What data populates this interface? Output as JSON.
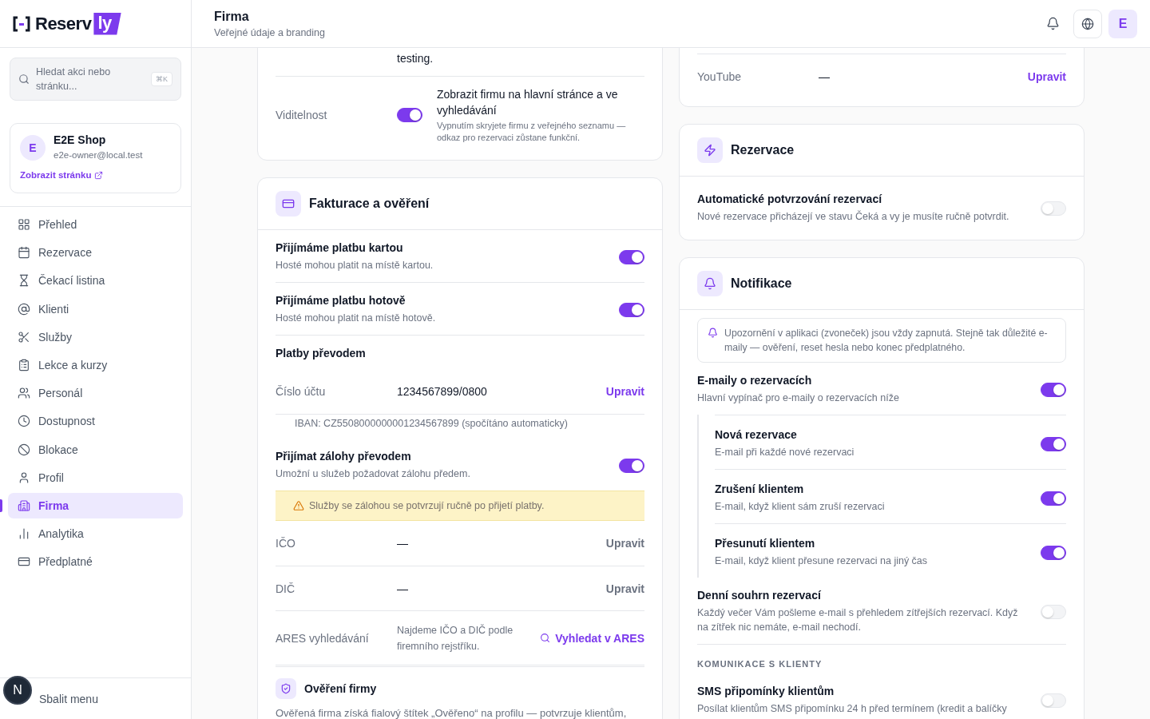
{
  "brand": {
    "name": "Reserv",
    "badge": "ly"
  },
  "search": {
    "placeholder": "Hledat akci nebo stránku...",
    "shortcut": "⌘K"
  },
  "shop": {
    "avatar": "E",
    "name": "E2E Shop",
    "email": "e2e-owner@local.test",
    "link": "Zobrazit stránku"
  },
  "nav": [
    {
      "label": "Přehled",
      "selected": false
    },
    {
      "label": "Rezervace",
      "selected": false
    },
    {
      "label": "Čekací listina",
      "selected": false
    },
    {
      "label": "Klienti",
      "selected": false
    },
    {
      "label": "Služby",
      "selected": false
    },
    {
      "label": "Lekce a kurzy",
      "selected": false
    },
    {
      "label": "Personál",
      "selected": false
    },
    {
      "label": "Dostupnost",
      "selected": false
    },
    {
      "label": "Blokace",
      "selected": false
    },
    {
      "label": "Profil",
      "selected": false
    },
    {
      "label": "Firma",
      "selected": true
    },
    {
      "label": "Analytika",
      "selected": false
    },
    {
      "label": "Předplatné",
      "selected": false
    }
  ],
  "collapse": "Sbalit menu",
  "dev_badge": "N",
  "header": {
    "title": "Firma",
    "subtitle": "Veřejné údaje a branding",
    "avatar": "E"
  },
  "profile_card": {
    "rows": [
      {
        "kind": "text",
        "value": "testing."
      },
      {
        "kind": "toggle",
        "label": "Viditelnost",
        "on": true,
        "title": "Zobrazit firmu na hlavní stránce a ve vyhledávání",
        "description": "Vypnutím skryjete firmu z veřejného seznamu — odkaz pro rezervaci zůstane funkční."
      }
    ]
  },
  "billing": {
    "title": "Fakturace a ověření",
    "items": [
      {
        "kind": "toggle",
        "title": "Přijímáme platbu kartou",
        "description": "Hosté mohou platit na místě kartou.",
        "on": true
      },
      {
        "kind": "toggle",
        "title": "Přijímáme platbu hotově",
        "description": "Hosté mohou platit na místě hotově.",
        "on": true
      },
      {
        "kind": "subheading",
        "title": "Platby převodem"
      },
      {
        "kind": "field",
        "label": "Číslo účtu",
        "value": "1234567899/0800",
        "action": "Upravit",
        "disabled": false
      },
      {
        "kind": "note",
        "text": "IBAN: CZ5508000000001234567899 (spočítáno automaticky)"
      },
      {
        "kind": "toggle",
        "title": "Přijímat zálohy převodem",
        "description": "Umožní u služeb požadovat zálohu předem.",
        "on": true
      },
      {
        "kind": "alert",
        "text": "Služby se zálohou se potvrzují ručně po přijetí platby."
      },
      {
        "kind": "field",
        "label": "IČO",
        "value": "—",
        "action": "Upravit",
        "disabled": true
      },
      {
        "kind": "field",
        "label": "DIČ",
        "value": "—",
        "action": "Upravit",
        "disabled": true
      },
      {
        "kind": "ares",
        "label": "ARES vyhledávání",
        "value": "Najdeme IČO a DIČ podle firemního rejstříku.",
        "action": "Vyhledat v ARES"
      },
      {
        "kind": "section",
        "title": "Ověření firmy",
        "description": "Ověřená firma získá fialový štítek „Ověřeno“ na profilu — potvrzuje klientům,"
      }
    ]
  },
  "socials": {
    "rows": [
      {
        "label": "YouTube",
        "value": "—",
        "action": "Upravit"
      }
    ]
  },
  "reservations": {
    "title": "Rezervace",
    "items": [
      {
        "kind": "toggle",
        "title": "Automatické potvrzování rezervací",
        "description": "Nové rezervace přicházejí ve stavu Čeká a vy je musíte ručně potvrdit.",
        "on": false
      }
    ]
  },
  "notifications": {
    "title": "Notifikace",
    "info": "Upozornění v aplikaci (zvoneček) jsou vždy zapnutá. Stejně tak důležité e-maily — ověření, reset hesla nebo konec předplatného.",
    "items": [
      {
        "kind": "toggle",
        "title": "E-maily o rezervacích",
        "description": "Hlavní vypínač pro e-maily o rezervacích níže",
        "on": true,
        "children": [
          {
            "title": "Nová rezervace",
            "description": "E-mail při každé nové rezervaci",
            "on": true
          },
          {
            "title": "Zrušení klientem",
            "description": "E-mail, když klient sám zruší rezervaci",
            "on": true
          },
          {
            "title": "Přesunutí klientem",
            "description": "E-mail, když klient přesune rezervaci na jiný čas",
            "on": true
          }
        ]
      },
      {
        "kind": "toggle",
        "title": "Denní souhrn rezervací",
        "description": "Každý večer Vám pošleme e-mail s přehledem zítřejších rezervací. Když na zítřek nic nemáte, e-mail nechodí.",
        "on": false
      },
      {
        "kind": "label",
        "title": "KOMUNIKACE S KLIENTY"
      },
      {
        "kind": "toggle",
        "title": "SMS připomínky klientům",
        "description": "Posílat klientům SMS připomínku 24 h před termínem (kredit a balíčky",
        "on": false
      }
    ]
  }
}
